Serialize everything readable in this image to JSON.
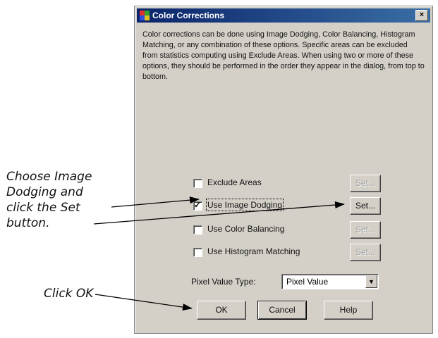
{
  "window": {
    "title": "Color Corrections",
    "close_glyph": "×"
  },
  "description": "Color corrections can be done using Image Dodging, Color Balancing, Histogram Matching, or any combination of these options. Specific areas can be excluded from statistics computing using Exclude Areas. When using two or more of these options, they should be performed in the order they appear in the dialog, from top to bottom.",
  "options": [
    {
      "label": "Exclude Areas",
      "checked": false,
      "set_label": "Set...",
      "set_enabled": false
    },
    {
      "label": "Use Image Dodging",
      "checked": true,
      "set_label": "Set...",
      "set_enabled": true
    },
    {
      "label": "Use Color Balancing",
      "checked": false,
      "set_label": "Set...",
      "set_enabled": false
    },
    {
      "label": "Use Histogram Matching",
      "checked": false,
      "set_label": "Set...",
      "set_enabled": false
    }
  ],
  "pixel_value": {
    "label": "Pixel Value Type:",
    "selected": "Pixel Value"
  },
  "buttons": {
    "ok": "OK",
    "cancel": "Cancel",
    "help": "Help"
  },
  "annotations": {
    "choose": "Choose Image Dodging and click the Set button.",
    "choose_lines": [
      "Choose Image",
      "Dodging and",
      "click the Set",
      "button."
    ],
    "click_ok": "Click OK"
  },
  "colors": {
    "titlebar_start": "#0a246a",
    "titlebar_end": "#3a6ea5",
    "dialog_bg": "#d4d0c8"
  }
}
